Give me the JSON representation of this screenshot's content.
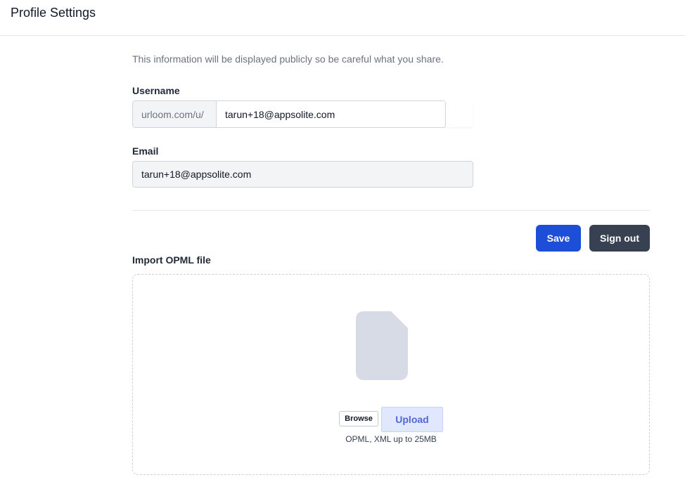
{
  "header": {
    "title": "Profile Settings"
  },
  "intro_text": "This information will be displayed publicly so be careful what you share.",
  "username": {
    "label": "Username",
    "prefix": "urloom.com/u/",
    "value": "tarun+18@appsolite.com"
  },
  "email": {
    "label": "Email",
    "value": "tarun+18@appsolite.com"
  },
  "actions": {
    "save_label": "Save",
    "signout_label": "Sign out"
  },
  "import": {
    "label": "Import OPML file",
    "icon": "file-icon",
    "browse_label": "Browse",
    "upload_label": "Upload",
    "hint": "OPML, XML up to 25MB"
  },
  "colors": {
    "primary": "#1d4ed8",
    "secondary": "#374151",
    "upload_bg": "#e0e7ff",
    "upload_text": "#4f68d6",
    "file_icon": "#d7dbe5"
  }
}
